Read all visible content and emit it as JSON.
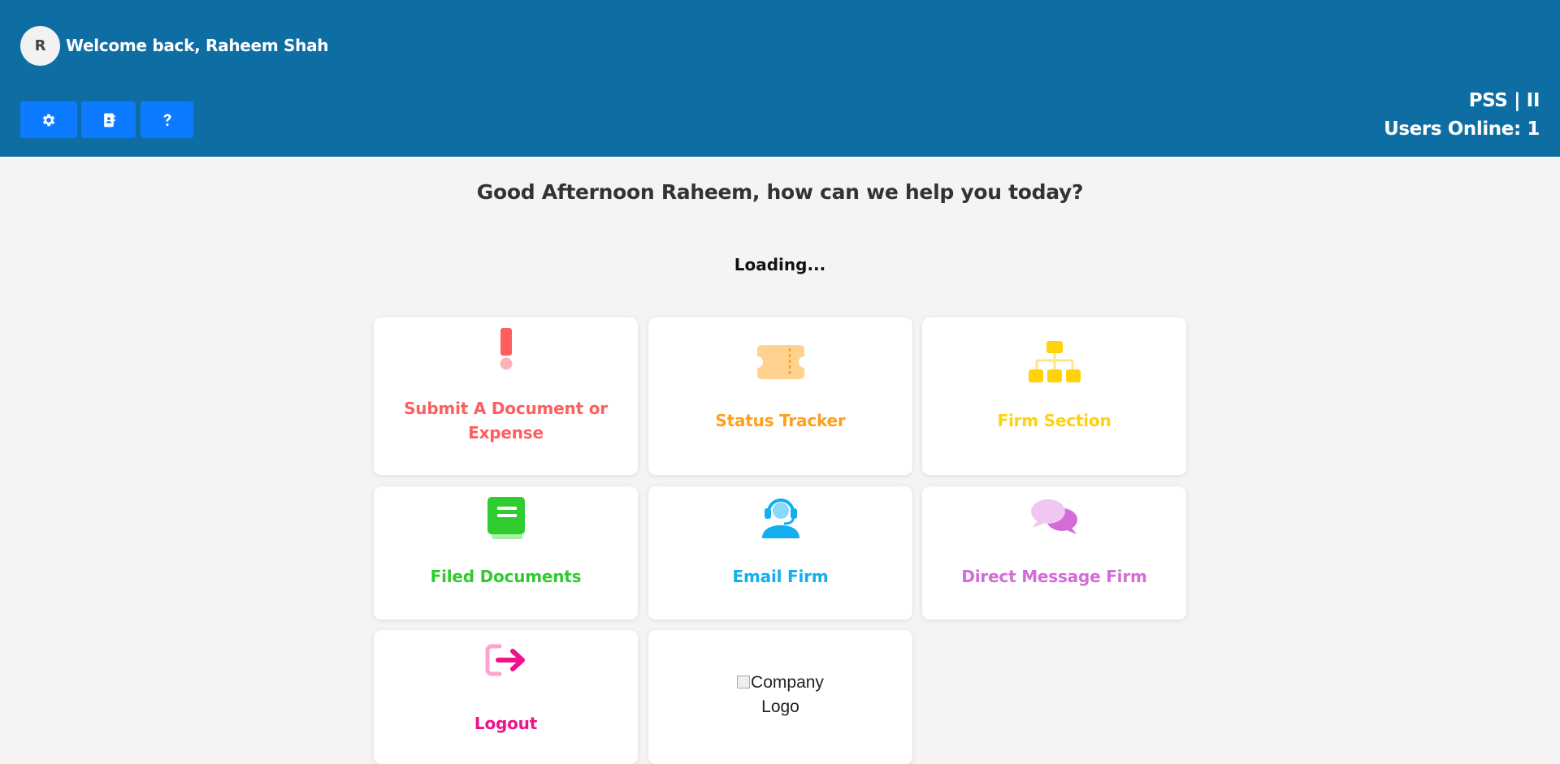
{
  "header": {
    "avatar_letter": "R",
    "welcome": "Welcome back, Raheem Shah",
    "system": "PSS | II",
    "users_online": "Users Online: 1",
    "buttons": [
      {
        "icon": "gear-icon"
      },
      {
        "icon": "address-book-icon"
      },
      {
        "icon": "question-icon"
      }
    ]
  },
  "main": {
    "greeting": "Good Afternoon Raheem, how can we help you today?",
    "loading": "Loading..."
  },
  "cards": [
    {
      "label_line1": "Submit A Document or",
      "label_line2": "Expense",
      "icon": "exclamation-icon",
      "color": "#ff5e5e"
    },
    {
      "label": "Status Tracker",
      "icon": "ticket-icon",
      "color": "#ff9f1a"
    },
    {
      "label": "Firm Section",
      "icon": "org-chart-icon",
      "color": "#ffd20a"
    },
    {
      "label": "Filed Documents",
      "icon": "book-icon",
      "color": "#2ecc2e"
    },
    {
      "label": "Email Firm",
      "icon": "headset-icon",
      "color": "#12aef0"
    },
    {
      "label": "Direct Message Firm",
      "icon": "chat-bubbles-icon",
      "color": "#d36bd8"
    },
    {
      "label": "Logout",
      "icon": "logout-icon",
      "color": "#f0128a"
    },
    {
      "logo_alt_line1": "Company",
      "logo_alt_line2": "Logo"
    }
  ]
}
